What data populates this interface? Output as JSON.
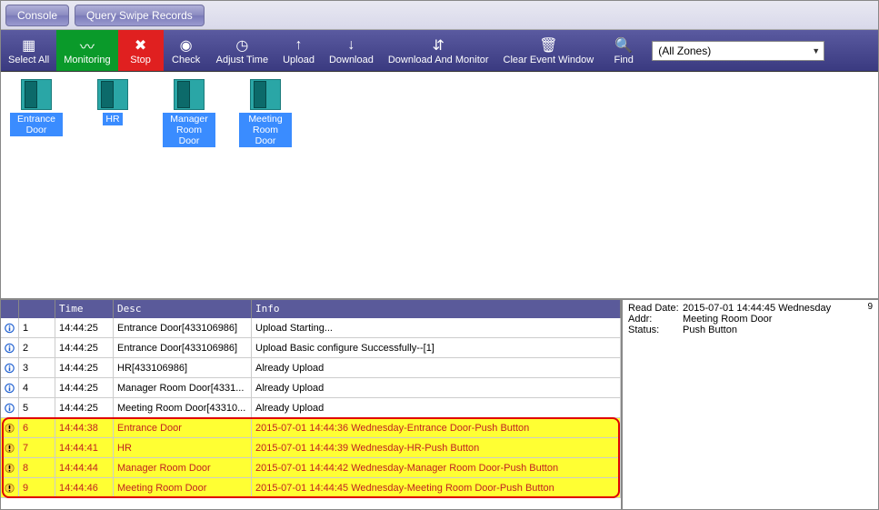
{
  "top": {
    "console": "Console",
    "query": "Query Swipe Records"
  },
  "toolbar": {
    "select_all": "Select All",
    "monitoring": "Monitoring",
    "stop": "Stop",
    "check": "Check",
    "adjust_time": "Adjust Time",
    "upload": "Upload",
    "download": "Download",
    "download_monitor": "Download And Monitor",
    "clear": "Clear Event Window",
    "find": "Find",
    "zone_selected": "(All Zones)"
  },
  "doors": [
    {
      "label": "Entrance Door"
    },
    {
      "label": "HR"
    },
    {
      "label": "Manager Room  Door"
    },
    {
      "label": "Meeting Room Door"
    }
  ],
  "log": {
    "headers": {
      "time": "Time",
      "desc": "Desc",
      "info": "Info"
    },
    "rows": [
      {
        "type": "info",
        "n": "1",
        "time": "14:44:25",
        "desc": "Entrance Door[433106986]",
        "info": "Upload Starting..."
      },
      {
        "type": "info",
        "n": "2",
        "time": "14:44:25",
        "desc": "Entrance Door[433106986]",
        "info": "Upload Basic configure Successfully--[1]"
      },
      {
        "type": "info",
        "n": "3",
        "time": "14:44:25",
        "desc": "HR[433106986]",
        "info": "Already Upload"
      },
      {
        "type": "info",
        "n": "4",
        "time": "14:44:25",
        "desc": "Manager Room  Door[4331...",
        "info": "Already Upload"
      },
      {
        "type": "info",
        "n": "5",
        "time": "14:44:25",
        "desc": "Meeting Room Door[43310...",
        "info": "Already Upload"
      },
      {
        "type": "warn",
        "n": "6",
        "time": "14:44:38",
        "desc": "Entrance Door",
        "info": "2015-07-01 14:44:36 Wednesday-Entrance Door-Push Button"
      },
      {
        "type": "warn",
        "n": "7",
        "time": "14:44:41",
        "desc": "HR",
        "info": "2015-07-01 14:44:39 Wednesday-HR-Push Button"
      },
      {
        "type": "warn",
        "n": "8",
        "time": "14:44:44",
        "desc": "Manager Room  Door",
        "info": "2015-07-01 14:44:42 Wednesday-Manager Room  Door-Push Button"
      },
      {
        "type": "warn",
        "n": "9",
        "time": "14:44:46",
        "desc": "Meeting Room Door",
        "info": "2015-07-01 14:44:45 Wednesday-Meeting Room Door-Push Button"
      }
    ]
  },
  "detail": {
    "corner": "9",
    "read_date_lbl": "Read Date:",
    "read_date_val": "2015-07-01 14:44:45 Wednesday",
    "addr_lbl": "Addr:",
    "addr_val": "Meeting Room Door",
    "status_lbl": "Status:",
    "status_val": "Push Button"
  }
}
